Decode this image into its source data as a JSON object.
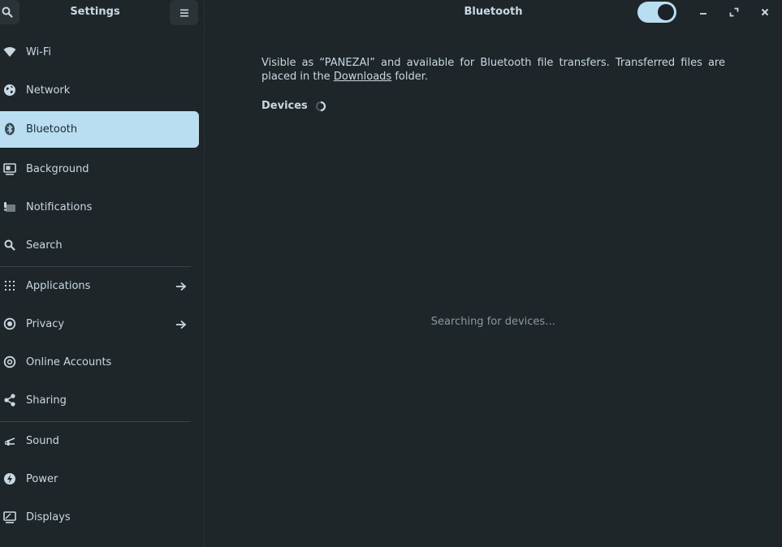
{
  "sidebar": {
    "title": "Settings",
    "search_icon": "search-icon",
    "menu_icon": "hamburger-menu-icon",
    "items": [
      {
        "label": "Wi-Fi",
        "icon": "wifi-icon"
      },
      {
        "label": "Network",
        "icon": "globe-icon"
      },
      {
        "label": "Bluetooth",
        "icon": "bluetooth-icon",
        "active": true
      },
      {
        "label": "Background",
        "icon": "monitor-icon"
      },
      {
        "label": "Notifications",
        "icon": "notifications-icon"
      },
      {
        "label": "Search",
        "icon": "search-icon"
      },
      {
        "label": "Applications",
        "icon": "apps-grid-icon",
        "arrow": true
      },
      {
        "label": "Privacy",
        "icon": "privacy-icon",
        "arrow": true
      },
      {
        "label": "Online Accounts",
        "icon": "at-sign-icon"
      },
      {
        "label": "Sharing",
        "icon": "share-icon"
      },
      {
        "label": "Sound",
        "icon": "volume-icon"
      },
      {
        "label": "Power",
        "icon": "power-icon"
      },
      {
        "label": "Displays",
        "icon": "display-icon"
      }
    ]
  },
  "header": {
    "title": "Bluetooth",
    "toggle_on": true,
    "minimize_icon": "minimize-icon",
    "maximize_icon": "maximize-icon",
    "close_icon": "close-icon"
  },
  "content": {
    "desc_prefix": "Visible as “PANEZAI” and available for Bluetooth file transfers. Transferred files are placed in the ",
    "desc_link": "Downloads",
    "desc_suffix": " folder.",
    "devices_label": "Devices",
    "searching_text": "Searching for devices…"
  },
  "colors": {
    "background": "#1f262a",
    "accent": "#b9def1",
    "text": "#c8d8e2",
    "muted_text": "#8a99a3"
  }
}
